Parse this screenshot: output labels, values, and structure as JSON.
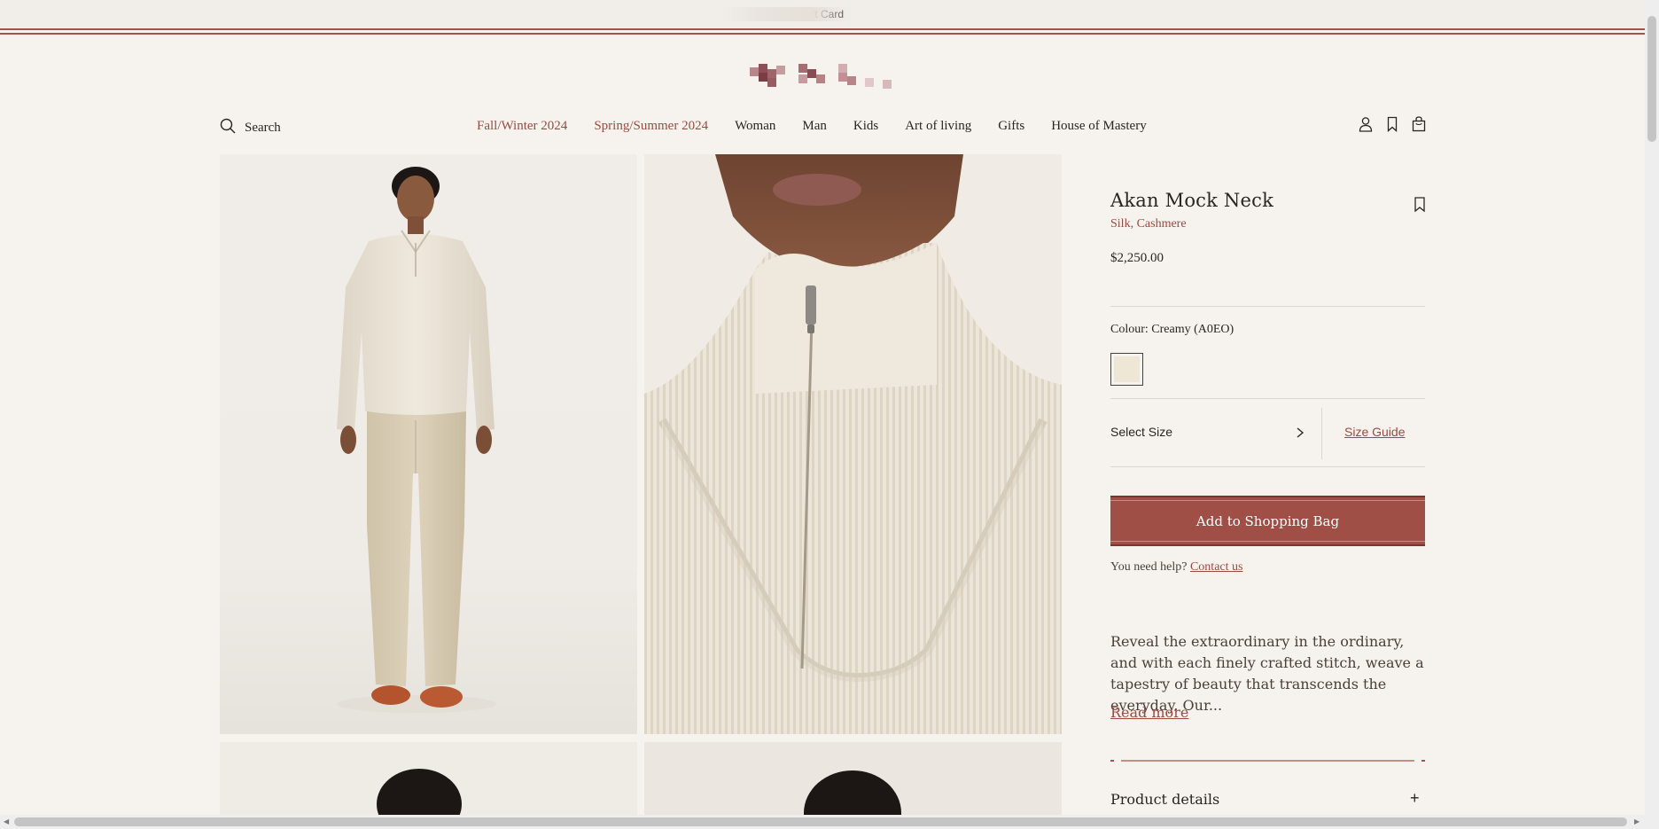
{
  "announcement": {
    "text": "Gift Card"
  },
  "header": {
    "search_label": "Search",
    "nav": [
      {
        "label": "Fall/Winter 2024"
      },
      {
        "label": "Spring/Summer 2024"
      },
      {
        "label": "Woman"
      },
      {
        "label": "Man"
      },
      {
        "label": "Kids"
      },
      {
        "label": "Art of living"
      },
      {
        "label": "Gifts"
      },
      {
        "label": "House of Mastery"
      }
    ],
    "icons": [
      "account-icon",
      "wishlist-icon",
      "shopping-bag-icon"
    ]
  },
  "product": {
    "title": "Akan Mock Neck",
    "material": "Silk, Cashmere",
    "price": "$2,250.00",
    "colour_label": "Colour:",
    "colour_value": "Creamy (A0EO)",
    "swatch_color": "#efe7d6",
    "size_label": "Select Size",
    "size_guide": "Size Guide",
    "add_to_bag": "Add to Shopping Bag",
    "help_text": "You need help?",
    "contact_link": "Contact us",
    "description": "Reveal the extraordinary in the ordinary, and with each finely crafted stitch, weave a tapestry of beauty that transcends the everyday. Our...",
    "read_more": "Read more",
    "details_label": "Product details",
    "details_toggle": "+"
  },
  "gallery": {
    "images": [
      "model-full-length-photo",
      "collar-zip-closeup-photo",
      "model-back-photo",
      "model-back-closeup-photo"
    ]
  },
  "colors": {
    "accent": "#9b4a42",
    "button": "#a04f47",
    "background": "#f6f3ef"
  }
}
